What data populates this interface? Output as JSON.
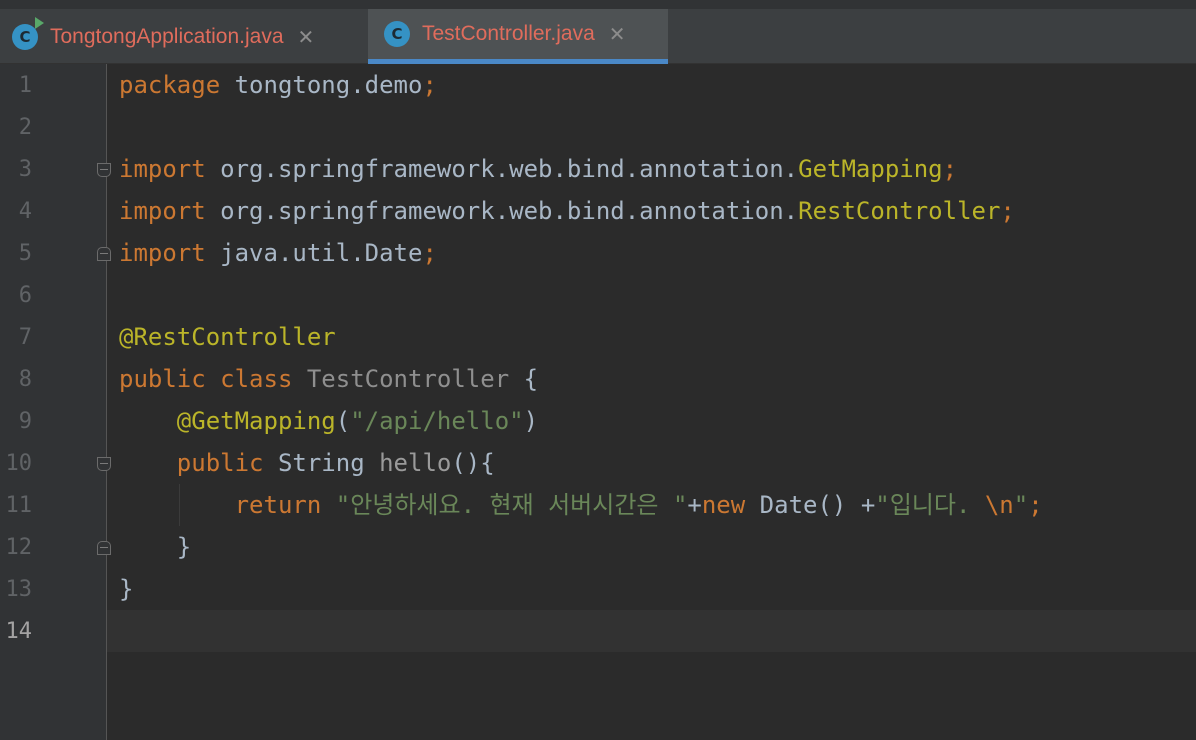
{
  "tabs": [
    {
      "label": "TongtongApplication.java",
      "icon": "java-class-run-icon",
      "active": false
    },
    {
      "label": "TestController.java",
      "icon": "java-class-icon",
      "active": true
    }
  ],
  "tab_icon_letter": "C",
  "close_glyph": "✕",
  "line_numbers": [
    "1",
    "2",
    "3",
    "4",
    "5",
    "6",
    "7",
    "8",
    "9",
    "10",
    "11",
    "12",
    "13",
    "14"
  ],
  "code": {
    "l1": {
      "kw": "package",
      "sp": " ",
      "pkg": "tongtong.demo",
      "semi": ";"
    },
    "l3": {
      "kw": "import",
      "path": " org.springframework.web.bind.annotation.",
      "cls": "GetMapping",
      "semi": ";"
    },
    "l4": {
      "kw": "import",
      "path": " org.springframework.web.bind.annotation.",
      "cls": "RestController",
      "semi": ";"
    },
    "l5": {
      "kw": "import",
      "path": " java.util.Date",
      "semi": ";"
    },
    "l7": {
      "ann": "@RestController"
    },
    "l8": {
      "kw1": "public",
      "kw2": " class",
      "cls": " TestController",
      "brace": " {"
    },
    "l9": {
      "indent": "    ",
      "ann": "@GetMapping",
      "open": "(",
      "str": "\"/api/hello\"",
      "close": ")"
    },
    "l10": {
      "indent": "    ",
      "kw": "public",
      "type": " String",
      "fn": " hello",
      "paren": "(){"
    },
    "l11": {
      "indent": "        ",
      "kw": "return",
      "str1": " \"안녕하세요. 현재 서버시간은 \"",
      "plus1": "+",
      "kw2": "new",
      "date": " Date() ",
      "plus2": "+",
      "str2": "\"입니다. ",
      "esc": "\\n",
      "str3": "\"",
      "semi": ";"
    },
    "l12": {
      "indent": "    ",
      "brace": "}"
    },
    "l13": {
      "brace": "}"
    }
  },
  "colors": {
    "keyword": "#cc7832",
    "annotation": "#bbb529",
    "string": "#6a8759",
    "text": "#a9b7c6",
    "tab_label": "#e06c5c",
    "tab_active_underline": "#4a88c7"
  }
}
